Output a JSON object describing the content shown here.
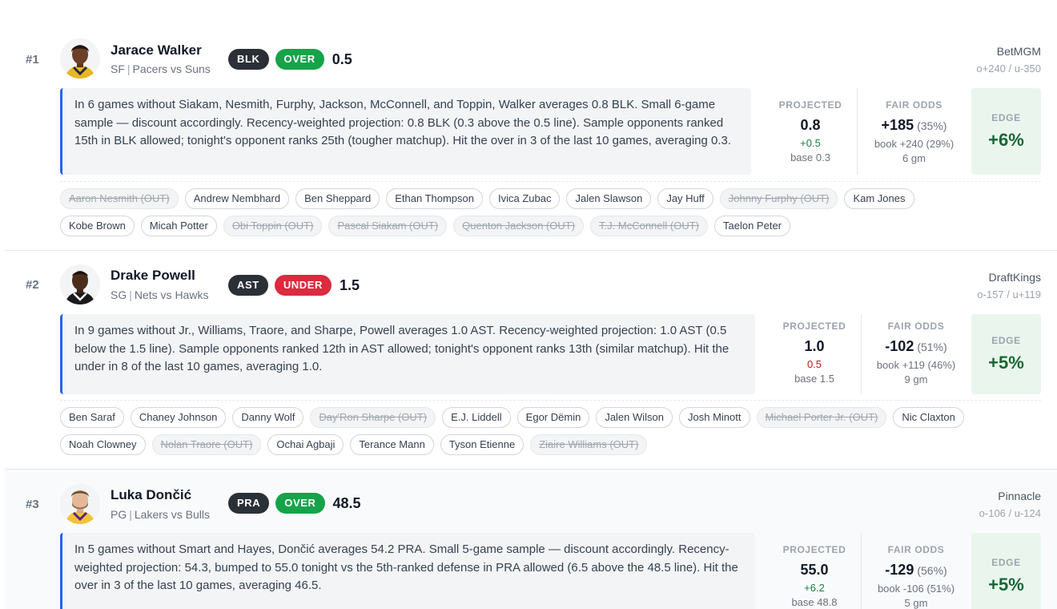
{
  "props": [
    {
      "rank": "#1",
      "player": "Jarace Walker",
      "position": "SF",
      "matchup": "Pacers vs Suns",
      "stat": "BLK",
      "side": "OVER",
      "line": "0.5",
      "book": "BetMGM",
      "book_odds": "o+240 / u-350",
      "analysis": "In 6 games without Siakam, Nesmith, Furphy, Jackson, McConnell, and Toppin, Walker averages 0.8 BLK. Small 6-game sample — discount accordingly. Recency-weighted projection: 0.8 BLK (0.3 above the 0.5 line). Sample opponents ranked 15th in BLK allowed; tonight's opponent ranks 25th (tougher matchup). Hit the over in 3 of the last 10 games, averaging 0.3.",
      "projected_label": "PROJECTED",
      "projected": "0.8",
      "projected_delta": "+0.5",
      "projected_base": "base 0.3",
      "fair_label": "FAIR ODDS",
      "fair_odds": "+185",
      "fair_pct": "(35%)",
      "book_line": "book +240 (29%)",
      "games": "6 gm",
      "edge_label": "EDGE",
      "edge": "+6%",
      "teammates": [
        {
          "name": "Aaron Nesmith (OUT)",
          "out": true
        },
        {
          "name": "Andrew Nembhard",
          "out": false
        },
        {
          "name": "Ben Sheppard",
          "out": false
        },
        {
          "name": "Ethan Thompson",
          "out": false
        },
        {
          "name": "Ivica Zubac",
          "out": false
        },
        {
          "name": "Jalen Slawson",
          "out": false
        },
        {
          "name": "Jay Huff",
          "out": false
        },
        {
          "name": "Johnny Furphy (OUT)",
          "out": true
        },
        {
          "name": "Kam Jones",
          "out": false
        },
        {
          "name": "Kobe Brown",
          "out": false
        },
        {
          "name": "Micah Potter",
          "out": false
        },
        {
          "name": "Obi Toppin (OUT)",
          "out": true
        },
        {
          "name": "Pascal Siakam (OUT)",
          "out": true
        },
        {
          "name": "Quenton Jackson (OUT)",
          "out": true
        },
        {
          "name": "T.J. McConnell (OUT)",
          "out": true
        },
        {
          "name": "Taelon Peter",
          "out": false
        }
      ]
    },
    {
      "rank": "#2",
      "player": "Drake Powell",
      "position": "SG",
      "matchup": "Nets vs Hawks",
      "stat": "AST",
      "side": "UNDER",
      "line": "1.5",
      "book": "DraftKings",
      "book_odds": "o-157 / u+119",
      "analysis": "In 9 games without Jr., Williams, Traore, and Sharpe, Powell averages 1.0 AST. Recency-weighted projection: 1.0 AST (0.5 below the 1.5 line). Sample opponents ranked 12th in AST allowed; tonight's opponent ranks 13th (similar matchup). Hit the under in 8 of the last 10 games, averaging 1.0.",
      "projected_label": "PROJECTED",
      "projected": "1.0",
      "projected_delta": "0.5",
      "projected_base": "base 1.5",
      "fair_label": "FAIR ODDS",
      "fair_odds": "-102",
      "fair_pct": "(51%)",
      "book_line": "book +119 (46%)",
      "games": "9 gm",
      "edge_label": "EDGE",
      "edge": "+5%",
      "teammates": [
        {
          "name": "Ben Saraf",
          "out": false
        },
        {
          "name": "Chaney Johnson",
          "out": false
        },
        {
          "name": "Danny Wolf",
          "out": false
        },
        {
          "name": "Day'Ron Sharpe (OUT)",
          "out": true
        },
        {
          "name": "E.J. Liddell",
          "out": false
        },
        {
          "name": "Egor Dëmin",
          "out": false
        },
        {
          "name": "Jalen Wilson",
          "out": false
        },
        {
          "name": "Josh Minott",
          "out": false
        },
        {
          "name": "Michael Porter Jr. (OUT)",
          "out": true
        },
        {
          "name": "Nic Claxton",
          "out": false
        },
        {
          "name": "Noah Clowney",
          "out": false
        },
        {
          "name": "Nolan Traore (OUT)",
          "out": true
        },
        {
          "name": "Ochai Agbaji",
          "out": false
        },
        {
          "name": "Terance Mann",
          "out": false
        },
        {
          "name": "Tyson Etienne",
          "out": false
        },
        {
          "name": "Ziaire Williams (OUT)",
          "out": true
        }
      ]
    },
    {
      "rank": "#3",
      "player": "Luka Dončić",
      "position": "PG",
      "matchup": "Lakers vs Bulls",
      "stat": "PRA",
      "side": "OVER",
      "line": "48.5",
      "book": "Pinnacle",
      "book_odds": "o-106 / u-124",
      "analysis": "In 5 games without Smart and Hayes, Dončić averages 54.2 PRA. Small 5-game sample — discount accordingly. Recency-weighted projection: 54.3, bumped to 55.0 tonight vs the 5th-ranked defense in PRA allowed (6.5 above the 48.5 line). Hit the over in 3 of the last 10 games, averaging 46.5.",
      "projected_label": "PROJECTED",
      "projected": "55.0",
      "projected_delta": "+6.2",
      "projected_base": "base 48.8",
      "fair_label": "FAIR ODDS",
      "fair_odds": "-129",
      "fair_pct": "(56%)",
      "book_line": "book -106 (51%)",
      "games": "5 gm",
      "edge_label": "EDGE",
      "edge": "+5%",
      "teammates": []
    }
  ]
}
